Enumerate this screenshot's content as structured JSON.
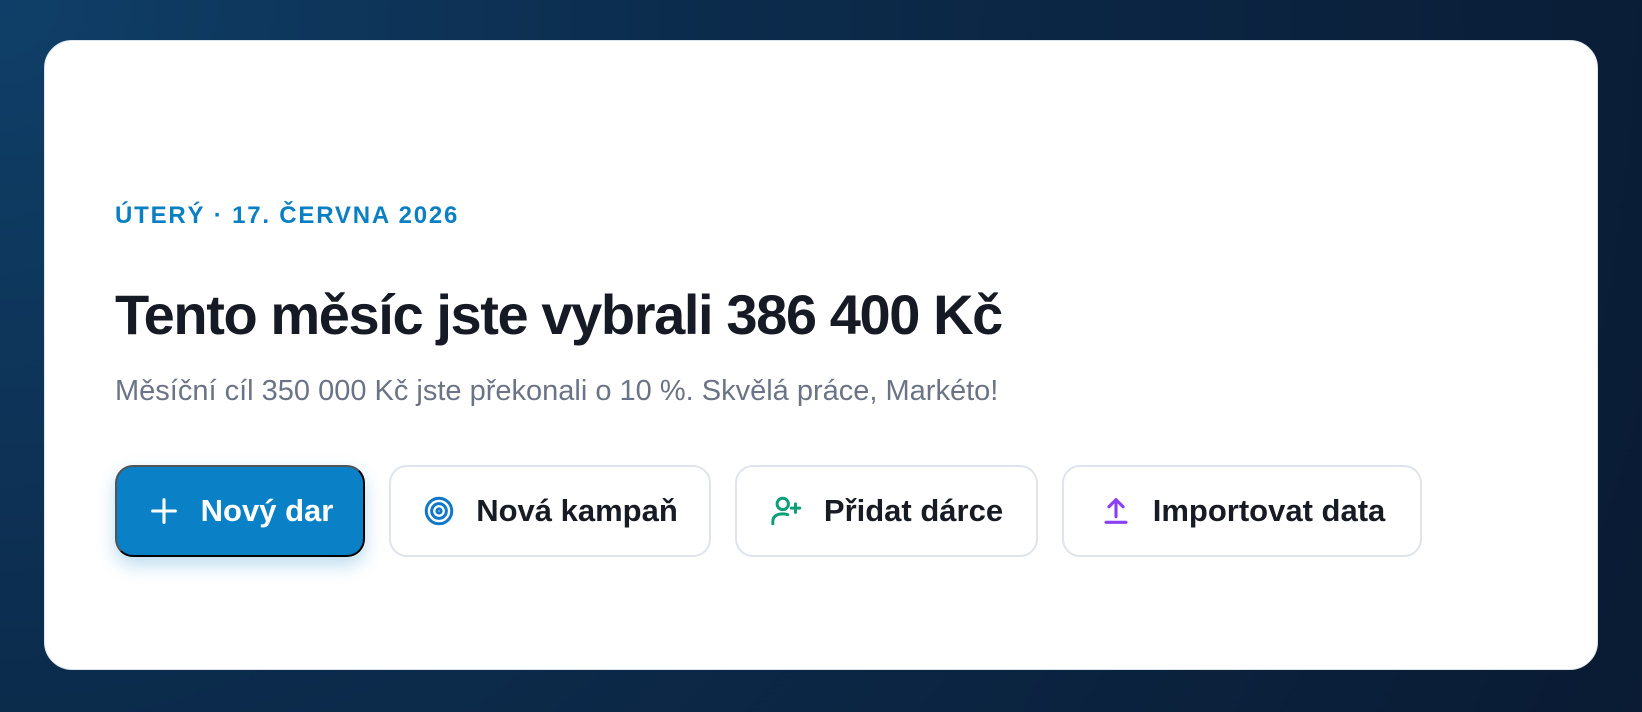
{
  "header": {
    "date_label": "ÚTERÝ · 17. ČERVNA 2026",
    "title": "Tento měsíc jste vybrali 386 400 Kč",
    "subtitle": "Měsíční cíl 350 000 Kč jste překonali o 10 %. Skvělá práce, Markéto!"
  },
  "actions": [
    {
      "label": "Nový dar",
      "icon": "plus-icon",
      "variant": "primary",
      "color": "#ffffff"
    },
    {
      "label": "Nová kampaň",
      "icon": "target-icon",
      "variant": "secondary",
      "color": "#1177c8"
    },
    {
      "label": "Přidat dárce",
      "icon": "add-user-icon",
      "variant": "secondary",
      "color": "#0d9f79"
    },
    {
      "label": "Importovat data",
      "icon": "upload-icon",
      "variant": "secondary",
      "color": "#8a3ff5"
    }
  ],
  "theme": {
    "accent": "#0a80c6",
    "background_dark": "#0a1b33",
    "card_background": "#ffffff",
    "title_text": "#151a24",
    "muted_text": "#6b7486"
  }
}
